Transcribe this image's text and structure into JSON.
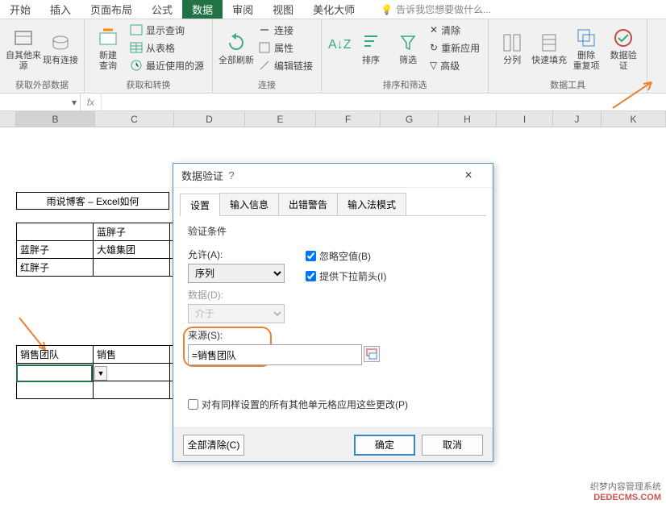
{
  "ribbon": {
    "tabs": [
      "开始",
      "插入",
      "页面布局",
      "公式",
      "数据",
      "审阅",
      "视图",
      "美化大师"
    ],
    "active_tab": "数据",
    "tell_me": "告诉我您想要做什么...",
    "groups": {
      "g1": {
        "label": "获取外部数据",
        "btn_other": "自其他来源",
        "btn_conn": "现有连接"
      },
      "g2": {
        "label": "获取和转换",
        "btn_new": "新建\n查询",
        "i_show": "显示查询",
        "i_table": "从表格",
        "i_recent": "最近使用的源"
      },
      "g3": {
        "label": "连接",
        "btn_refresh": "全部刷新",
        "i_conn": "连接",
        "i_prop": "属性",
        "i_edit": "编辑链接"
      },
      "g4": {
        "label": "排序和筛选",
        "btn_sort": "排序",
        "btn_filter": "筛选",
        "i_clear": "清除",
        "i_reapply": "重新应用",
        "i_adv": "高级"
      },
      "g5": {
        "label": "数据工具",
        "btn_split": "分列",
        "btn_flash": "快速填充",
        "btn_dup": "删除\n重复项",
        "btn_valid": "数据验\n证"
      }
    }
  },
  "sheet": {
    "cols": [
      "B",
      "C",
      "D",
      "E",
      "F",
      "G",
      "H",
      "I",
      "J",
      "K"
    ],
    "widths": [
      98,
      98,
      88,
      88,
      80,
      72,
      72,
      70,
      60,
      80
    ],
    "title": "雨说博客 – Excel如何",
    "table1": [
      [
        "",
        "蓝胖子",
        ""
      ],
      [
        "蓝胖子",
        "大雄集团",
        ""
      ],
      [
        "红胖子",
        "",
        ""
      ]
    ],
    "table2": [
      [
        "销售团队",
        "销售",
        ""
      ],
      [
        "",
        "",
        ""
      ],
      [
        "",
        "",
        ""
      ]
    ]
  },
  "dialog": {
    "title": "数据验证",
    "tabs": [
      "设置",
      "输入信息",
      "出错警告",
      "输入法模式"
    ],
    "section": "验证条件",
    "allow_label": "允许(A):",
    "allow_value": "序列",
    "ignore_blank": "忽略空值(B)",
    "dropdown": "提供下拉箭头(I)",
    "data_label": "数据(D):",
    "data_value": "介于",
    "source_label": "来源(S):",
    "source_value": "=销售团队",
    "apply_all": "对有同样设置的所有其他单元格应用这些更改(P)",
    "clear": "全部清除(C)",
    "ok": "确定",
    "cancel": "取消"
  },
  "watermark": {
    "l1": "织梦内容管理系统",
    "l2": "DEDECMS.COM"
  }
}
